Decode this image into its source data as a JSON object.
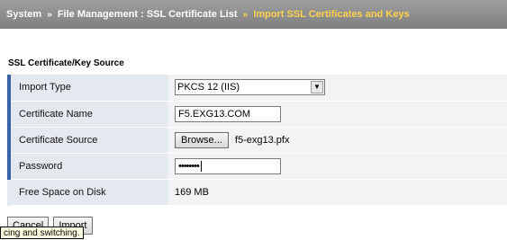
{
  "breadcrumb": {
    "items": [
      "System",
      "File Management : SSL Certificate List",
      "Import SSL Certificates and Keys"
    ],
    "separator": "»"
  },
  "section": {
    "title": "SSL Certificate/Key Source"
  },
  "fields": {
    "import_type": {
      "label": "Import Type",
      "value": "PKCS 12 (IIS)"
    },
    "certificate_name": {
      "label": "Certificate Name",
      "value": "F5.EXG13.COM"
    },
    "certificate_source": {
      "label": "Certificate Source",
      "browse_label": "Browse...",
      "file_name": "f5-exg13.pfx"
    },
    "password": {
      "label": "Password",
      "masked_value": "••••••••"
    },
    "free_space": {
      "label": "Free Space on Disk",
      "value": "169 MB"
    }
  },
  "buttons": {
    "cancel": "Cancel",
    "import": "Import"
  },
  "tooltip": {
    "text": "cing and switching."
  },
  "colors": {
    "header_bg": "#8c8c8c",
    "breadcrumb_current": "#ffd24d",
    "label_bar": "#3a62a7",
    "highlighter": "#ffec00"
  },
  "icons": {
    "select_arrow": "dropdown-arrow-icon"
  }
}
